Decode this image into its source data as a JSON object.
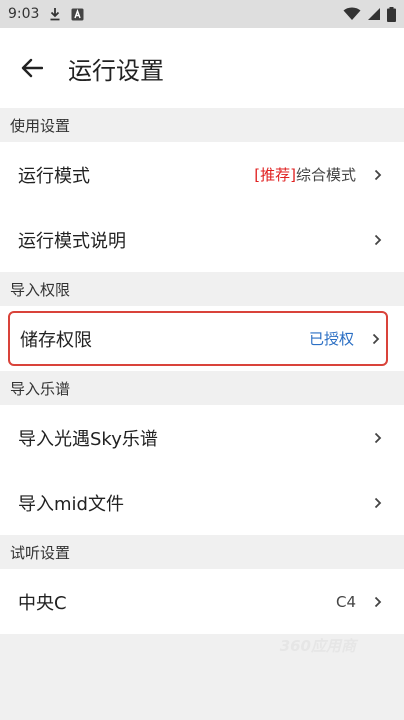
{
  "status_bar": {
    "time": "9:03",
    "left_icons": [
      "download-icon",
      "notification-a-icon"
    ],
    "right_icons": [
      "wifi-icon",
      "signal-icon",
      "battery-icon"
    ]
  },
  "app_bar": {
    "back_icon": "back-arrow-icon",
    "title": "运行设置"
  },
  "sections": {
    "usage": {
      "header": "使用设置",
      "run_mode": {
        "label": "运行模式",
        "tag": "[推荐]",
        "value": "综合模式"
      },
      "run_mode_help": {
        "label": "运行模式说明"
      }
    },
    "import_permission": {
      "header": "导入权限",
      "storage": {
        "label": "储存权限",
        "value": "已授权"
      }
    },
    "import_score": {
      "header": "导入乐谱",
      "sky": {
        "label": "导入光遇Sky乐谱"
      },
      "mid": {
        "label": "导入mid文件"
      }
    },
    "preview": {
      "header": "试听设置",
      "middle_c": {
        "label": "中央C",
        "value": "C4"
      }
    }
  },
  "watermark": "360应用商",
  "colors": {
    "accent_blue": "#2b6fc4",
    "tag_red": "#e02020",
    "highlight_border": "#d9433a"
  }
}
